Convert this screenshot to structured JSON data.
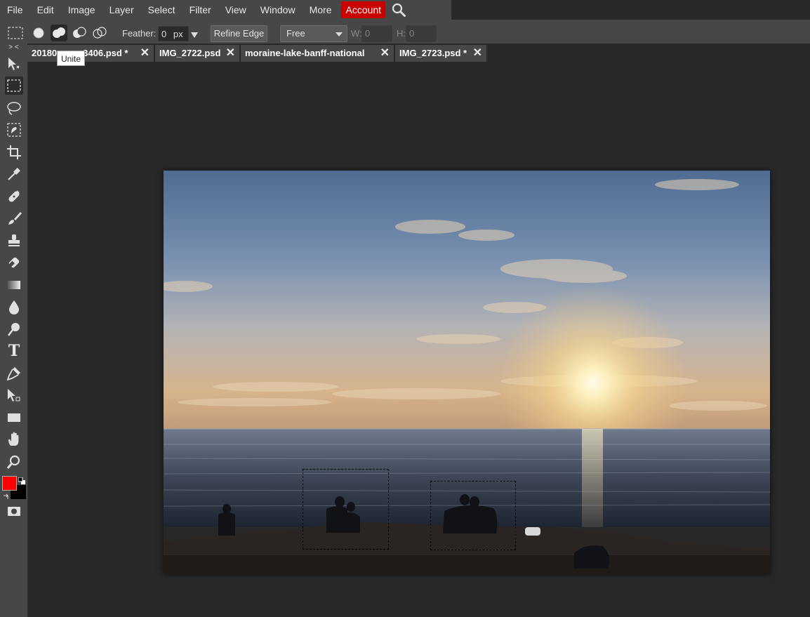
{
  "menubar": {
    "items": [
      "File",
      "Edit",
      "Image",
      "Layer",
      "Select",
      "Filter",
      "View",
      "Window",
      "More"
    ],
    "account_label": "Account",
    "search_icon": "magnifier-icon"
  },
  "options": {
    "feather_label": "Feather:",
    "feather_value": "0",
    "feather_unit": "px",
    "refine_edge_label": "Refine Edge",
    "style_value": "Free",
    "width_label": "W:",
    "width_value": "0",
    "height_label": "H:",
    "height_value": "0",
    "selection_modes": [
      "new-selection-icon",
      "unite-icon",
      "subtract-icon",
      "intersect-icon"
    ],
    "active_mode": "Unite"
  },
  "tooltip": {
    "text": "Unite"
  },
  "tabs": [
    {
      "label": "20180",
      "label_tail": "3406.psd *"
    },
    {
      "label": "IMG_2722.psd"
    },
    {
      "label": "moraine-lake-banff-national"
    },
    {
      "label": "IMG_2723.psd *"
    }
  ],
  "toolbar": {
    "collapse_label": "> <",
    "tools": [
      "move-icon",
      "rect-marquee-icon",
      "lasso-icon",
      "quick-select-icon",
      "crop-icon",
      "eyedropper-icon",
      "healing-icon",
      "brush-icon",
      "stamp-icon",
      "eraser-icon",
      "gradient-icon",
      "blur-icon",
      "dodge-icon",
      "type-icon",
      "pen-icon",
      "path-select-icon",
      "shape-icon",
      "hand-icon",
      "zoom-icon"
    ],
    "type_tool_glyph": "T",
    "foreground_color": "#ff0000",
    "background_color": "#000000"
  },
  "colors": {
    "accent": "#c90000",
    "panel": "#474747",
    "workspace": "#282828"
  }
}
